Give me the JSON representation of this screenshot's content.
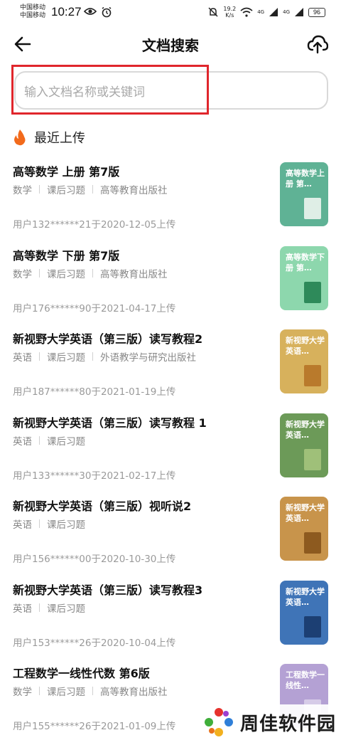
{
  "status_bar": {
    "carrier_1": "中国移动",
    "carrier_2": "中国移动",
    "time": "10:27",
    "net_speed_value": "19.2",
    "net_speed_unit": "K/s",
    "signal_1": "4G",
    "signal_2": "4G",
    "battery": "96",
    "icons": [
      "eye-icon",
      "alarm-icon",
      "mute-icon",
      "wifi-icon",
      "signal-icon",
      "signal-icon",
      "battery-icon"
    ]
  },
  "header": {
    "title": "文档搜索",
    "back_icon": "back-arrow-icon",
    "upload_icon": "cloud-upload-icon"
  },
  "search": {
    "placeholder": "输入文档名称或关键词",
    "highlight_color": "#e0262c"
  },
  "section": {
    "title": "最近上传",
    "icon": "flame-icon",
    "icon_color": "#f26a1b"
  },
  "documents": [
    {
      "title": "高等数学 上册 第7版",
      "tags": [
        "数学",
        "课后习题",
        "高等教育出版社"
      ],
      "meta": "用户132******21于2020-12-05上传",
      "cover_text": "高等数学上册 第…",
      "cover_color": "#5fb295",
      "cover_img_color": "#dfeee6"
    },
    {
      "title": "高等数学 下册 第7版",
      "tags": [
        "数学",
        "课后习题",
        "高等教育出版社"
      ],
      "meta": "用户176******90于2021-04-17上传",
      "cover_text": "高等数学下册 第…",
      "cover_color": "#8dd7ad",
      "cover_img_color": "#2e8a5a"
    },
    {
      "title": "新视野大学英语（第三版）读写教程2",
      "tags": [
        "英语",
        "课后习题",
        "外语教学与研究出版社"
      ],
      "meta": "用户187******80于2021-01-19上传",
      "cover_text": "新视野大学英语…",
      "cover_color": "#d7b15c",
      "cover_img_color": "#b97a2c"
    },
    {
      "title": "新视野大学英语（第三版）读写教程 1",
      "tags": [
        "英语",
        "课后习题"
      ],
      "meta": "用户133******30于2021-02-17上传",
      "cover_text": "新视野大学英语…",
      "cover_color": "#6c9a58",
      "cover_img_color": "#9fc079"
    },
    {
      "title": "新视野大学英语（第三版）视听说2",
      "tags": [
        "英语",
        "课后习题"
      ],
      "meta": "用户156******00于2020-10-30上传",
      "cover_text": "新视野大学英语…",
      "cover_color": "#c8944b",
      "cover_img_color": "#8d5a1f"
    },
    {
      "title": "新视野大学英语（第三版）读写教程3",
      "tags": [
        "英语",
        "课后习题"
      ],
      "meta": "用户153******26于2020-10-04上传",
      "cover_text": "新视野大学英语…",
      "cover_color": "#3f74b7",
      "cover_img_color": "#1c3f73"
    },
    {
      "title": "工程数学一线性代数 第6版",
      "tags": [
        "数学",
        "课后习题",
        "高等教育出版社"
      ],
      "meta": "用户155******26于2021-01-09上传",
      "cover_text": "工程数学一线性…",
      "cover_color": "#b4a1d4",
      "cover_img_color": "#d6cbe8"
    }
  ],
  "watermark": {
    "text": "周佳软件园"
  }
}
